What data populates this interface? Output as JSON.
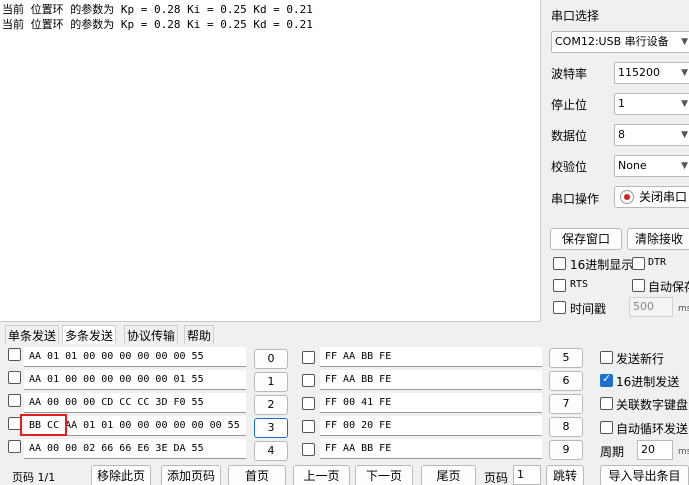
{
  "receive": {
    "lines": [
      "当前 位置环 的参数为 Kp = 0.28 Ki = 0.25 Kd = 0.21",
      "当前 位置环 的参数为 Kp = 0.28 Ki = 0.25 Kd = 0.21"
    ]
  },
  "settings": {
    "port_label": "串口选择",
    "port_value": "COM12:USB 串行设备",
    "baud_label": "波特率",
    "baud_value": "115200",
    "stopbits_label": "停止位",
    "stopbits_value": "1",
    "databits_label": "数据位",
    "databits_value": "8",
    "parity_label": "校验位",
    "parity_value": "None",
    "operation_label": "串口操作",
    "close_port_label": "关闭串口",
    "save_window_label": "保存窗口",
    "clear_recv_label": "清除接收",
    "hex_display_label": "16进制显示",
    "hex_display_checked": false,
    "dtr_label": "DTR",
    "dtr_checked": false,
    "rts_label": "RTS",
    "rts_checked": false,
    "auto_save_label": "自动保存",
    "auto_save_checked": false,
    "timestamp_label": "时间戳",
    "timestamp_checked": false,
    "timestamp_ms": "500",
    "ms_unit": "ms"
  },
  "tabs": [
    "单条发送",
    "多条发送",
    "协议传输",
    "帮助"
  ],
  "active_tab": 1,
  "multi_send": {
    "left_rows": [
      {
        "text": "AA 01 01 00 00 00 00 00 00 55",
        "checked": false,
        "button": "0"
      },
      {
        "text": "AA 01 00 00 00 00 00 00 01 55",
        "checked": false,
        "button": "1"
      },
      {
        "text": "AA 00 00 00 CD CC CC 3D F0 55",
        "checked": false,
        "button": "2"
      },
      {
        "text": "BB CC AA 01 01 00 00 00 00 00 00 55",
        "checked": false,
        "button": "3"
      },
      {
        "text": "AA 00 00 02 66 66 E6 3E DA 55",
        "checked": false,
        "button": "4"
      }
    ],
    "right_rows": [
      {
        "text": "FF AA BB FE",
        "checked": false,
        "button": "5"
      },
      {
        "text": "FF AA BB FE",
        "checked": false,
        "button": "6"
      },
      {
        "text": "FF 00 41 FE",
        "checked": false,
        "button": "7"
      },
      {
        "text": "FF 00 20 FE",
        "checked": false,
        "button": "8"
      },
      {
        "text": "FF AA BB FE",
        "checked": false,
        "button": "9"
      }
    ],
    "send_newline_label": "发送新行",
    "send_newline_checked": false,
    "hex_send_label": "16进制发送",
    "hex_send_checked": true,
    "numpad_label": "关联数字键盘",
    "numpad_checked": false,
    "loop_send_label": "自动循环发送",
    "loop_send_checked": false,
    "period_label": "周期",
    "period_value": "20",
    "period_unit": "ms"
  },
  "bottom": {
    "page_info": "页码 1/1",
    "remove_page": "移除此页",
    "add_page": "添加页码",
    "first_page": "首页",
    "prev_page": "上一页",
    "next_page": "下一页",
    "last_page": "尾页",
    "page_label": "页码",
    "page_value": "1",
    "jump": "跳转",
    "import_export": "导入导出条目"
  },
  "colors": {
    "accent": "#1a6fd1",
    "highlight": "#e02020",
    "record_red": "#d81e1e"
  }
}
